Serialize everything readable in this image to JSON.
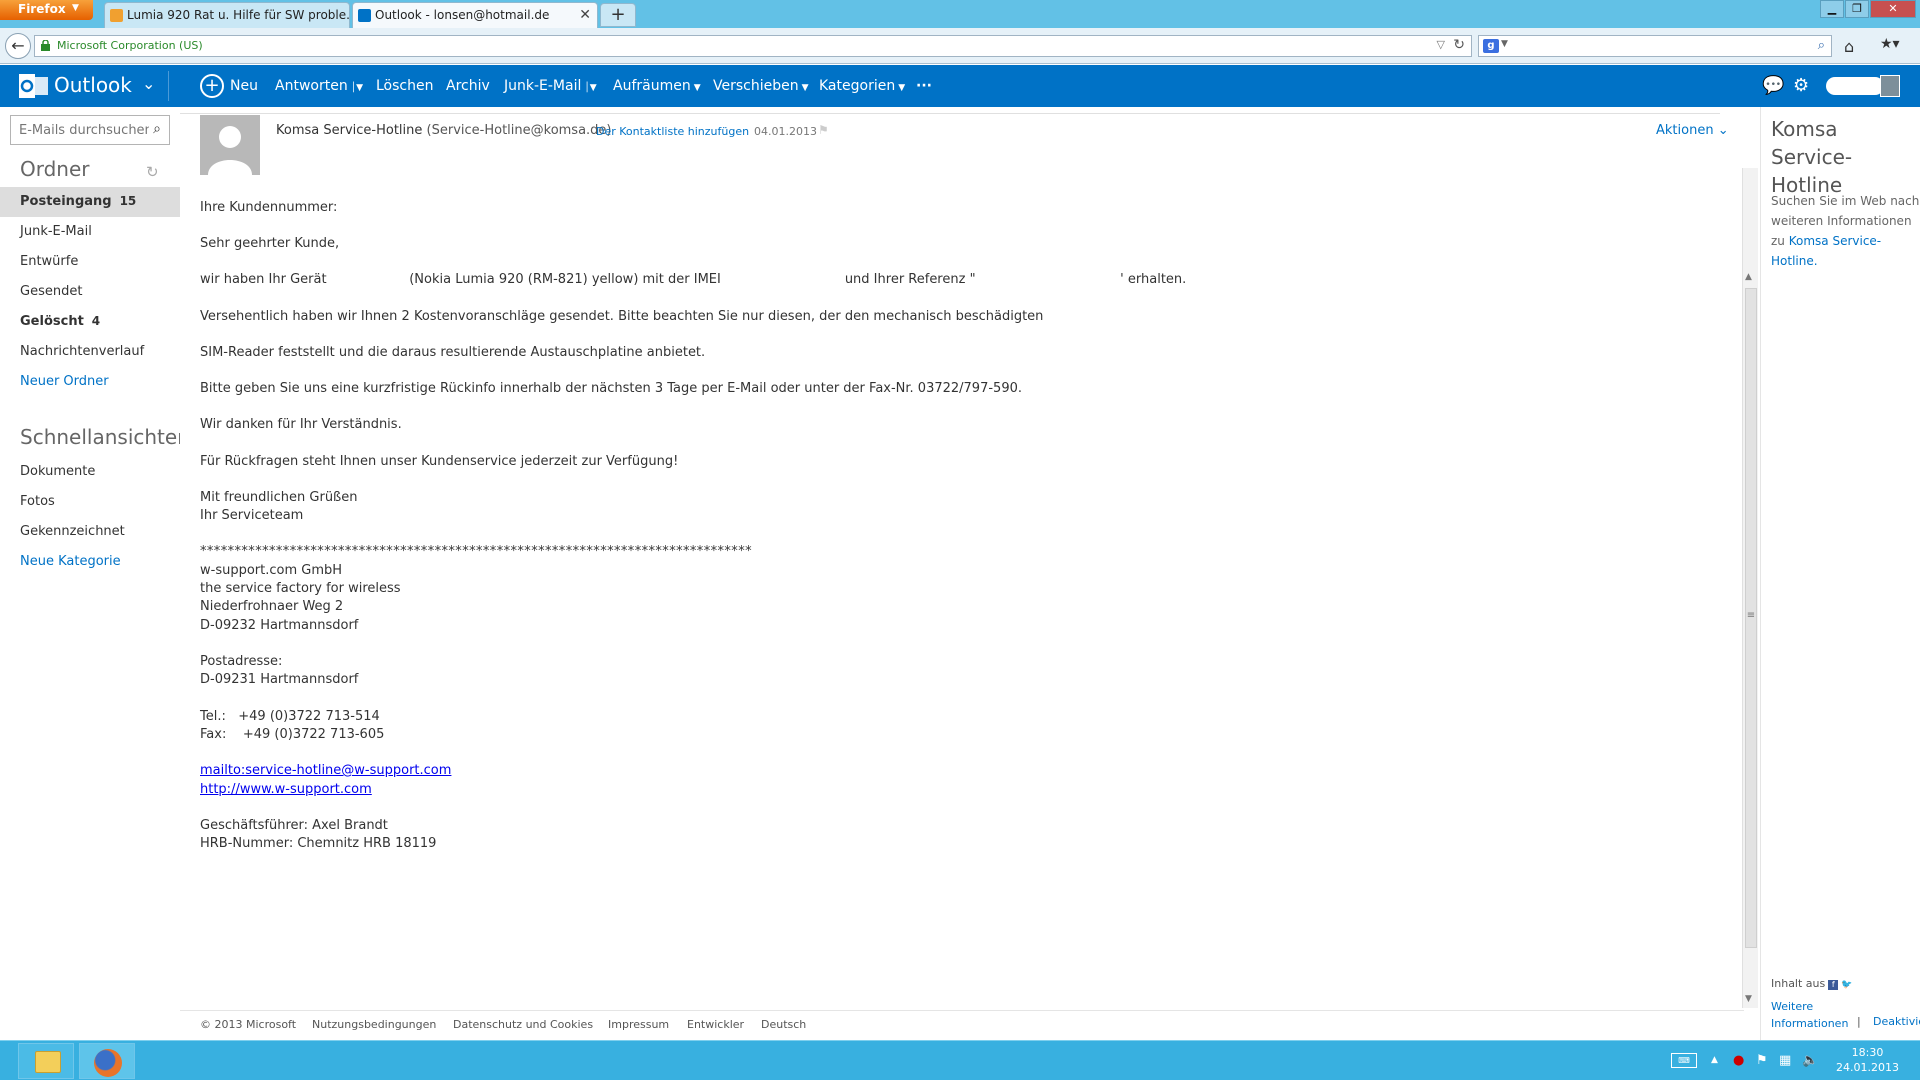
{
  "browser": {
    "menu_button": "Firefox",
    "tabs": [
      {
        "title": "Lumia 920 Rat u. Hilfe für SW proble..."
      },
      {
        "title": "Outlook - lonsen@hotmail.de"
      }
    ],
    "identity": "Microsoft Corporation (US)",
    "new_tab": "+"
  },
  "outlook_header": {
    "app_name": "Outlook",
    "commands": [
      "Neu",
      "Antworten",
      "Löschen",
      "Archiv",
      "Junk-E-Mail",
      "Aufräumen",
      "Verschieben",
      "Kategorien"
    ],
    "more": "···"
  },
  "sidebar": {
    "search_placeholder": "E-Mails durchsuchen",
    "folders_title": "Ordner",
    "folders": [
      {
        "label": "Posteingang",
        "count": "15"
      },
      {
        "label": "Junk-E-Mail",
        "count": ""
      },
      {
        "label": "Entwürfe",
        "count": ""
      },
      {
        "label": "Gesendet",
        "count": ""
      },
      {
        "label": "Gelöscht",
        "count": "4"
      },
      {
        "label": "Nachrichtenverlauf",
        "count": ""
      },
      {
        "label": "Neuer Ordner",
        "count": ""
      }
    ],
    "quickviews_title": "Schnellansichten",
    "quickviews": [
      "Dokumente",
      "Fotos",
      "Gekennzeichnet",
      "Neue Kategorie"
    ]
  },
  "message": {
    "sender_name": "Komsa Service-Hotline",
    "sender_email": "(Service-Hotline@komsa.de)",
    "add_contact": "Der Kontaktliste hinzufügen",
    "date": "04.01.2013",
    "actions": "Aktionen",
    "lines": [
      "Ihre Kundennummer:",
      "Sehr geehrter Kunde,",
      "wir haben Ihr Gerät                    (Nokia Lumia 920 (RM-821) yellow) mit der IMEI                              und Ihrer Referenz \"                                   ' erhalten.",
      "Versehentlich haben wir Ihnen 2 Kostenvoranschläge gesendet. Bitte beachten Sie nur diesen, der den mechanisch beschädigten",
      "SIM-Reader feststellt und die daraus resultierende Austauschplatine anbietet.",
      "Bitte geben Sie uns eine kurzfristige Rückinfo innerhalb der nächsten 3 Tage per E-Mail oder unter der Fax-Nr. 03722/797-590.",
      "Wir danken für Ihr Verständnis.",
      "Für Rückfragen steht Ihnen unser Kundenservice jederzeit zur Verfügung!",
      "Mit freundlichen Grüßen",
      "Ihr Serviceteam",
      "********************************************************************************",
      "w-support.com GmbH",
      "the service factory for wireless",
      "Niederfrohnaer Weg 2",
      "D-09232 Hartmannsdorf",
      "Postadresse:",
      "D-09231 Hartmannsdorf",
      "Tel.:   +49 (0)3722 713-514",
      "Fax:    +49 (0)3722 713-605",
      "Geschäftsführer: Axel Brandt",
      "HRB-Nummer: Chemnitz HRB 18119"
    ],
    "link_mail": "mailto:service-hotline@w-support.com",
    "link_web": "http://www.w-support.com"
  },
  "footer": [
    "© 2013 Microsoft",
    "Nutzungsbedingungen",
    "Datenschutz und Cookies",
    "Impressum",
    "Entwickler",
    "Deutsch"
  ],
  "right_pane": {
    "title": "Komsa Service-Hotline",
    "text": "Suchen Sie im Web nach weiteren Informationen zu",
    "link": "Komsa Service-Hotline.",
    "content_from": "Inhalt aus",
    "more_info": "Weitere Informationen",
    "separator": "|",
    "deactivate": "Deaktivieren"
  },
  "taskbar": {
    "time": "18:30",
    "date": "24.01.2013"
  },
  "colors": {
    "outlook_blue": "#0072c6",
    "firefox_orange": "#e66000",
    "taskbar": "#38b0e0"
  }
}
